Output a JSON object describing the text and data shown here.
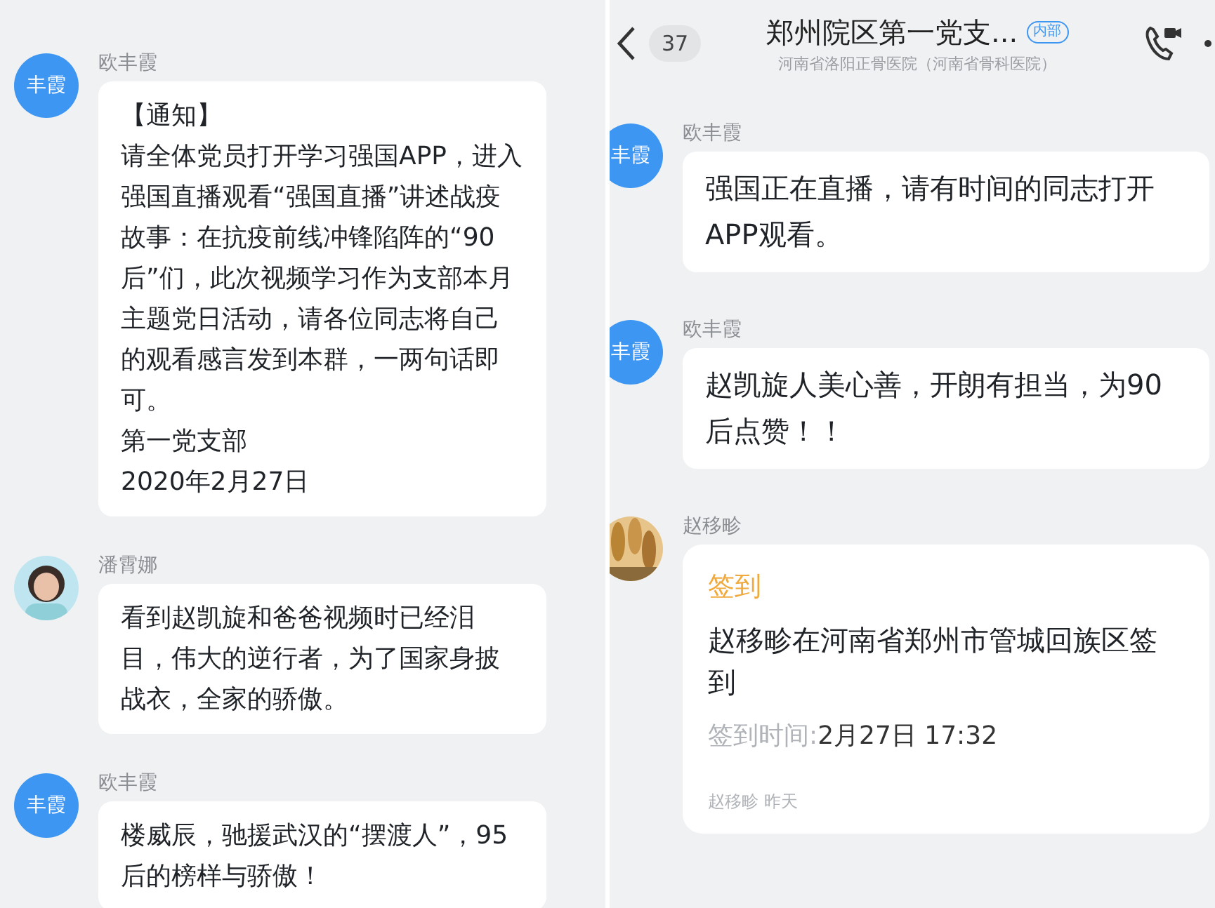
{
  "left_panel": {
    "messages": [
      {
        "sender": "欧丰霞",
        "avatar": {
          "kind": "initials",
          "text": "丰霞"
        },
        "kind": "text",
        "paragraphs": [
          "【通知】",
          "请全体党员打开学习强国APP，进入强国直播观看“强国直播”讲述战疫故事：在抗疫前线冲锋陷阵的“90后”们，此次视频学习作为支部本月主题党日活动，请各位同志将自己的观看感言发到本群，一两句话即可。",
          "第一党支部",
          "2020年2月27日"
        ]
      },
      {
        "sender": "潘霄娜",
        "kind": "text",
        "paragraphs": [
          "看到赵凯旋和爸爸视频时已经泪目，伟大的逆行者，为了国家身披战衣，全家的骄傲。"
        ]
      },
      {
        "sender": "欧丰霞",
        "avatar": {
          "kind": "initials",
          "text": "丰霞"
        },
        "kind": "text",
        "paragraphs": [
          "楼威辰，驰援武汉的“摆渡人”，95后的榜样与骄傲！"
        ]
      }
    ]
  },
  "right_panel": {
    "header": {
      "unread": "37",
      "title": "郑州院区第一党支...",
      "tag": "内部",
      "subtitle": "河南省洛阳正骨医院（河南省骨科医院）"
    },
    "messages": [
      {
        "sender": "欧丰霞",
        "avatar": {
          "kind": "initials",
          "text": "丰霞"
        },
        "kind": "text",
        "paragraphs": [
          "强国正在直播，请有时间的同志打开APP观看。"
        ]
      },
      {
        "sender": "欧丰霞",
        "avatar": {
          "kind": "initials",
          "text": "丰霞"
        },
        "kind": "text",
        "paragraphs": [
          "赵凯旋人美心善，开朗有担当，为90后点赞！！"
        ]
      },
      {
        "sender": "赵移畛",
        "kind": "checkin",
        "title": "签到",
        "body": "赵移畛在河南省郑州市管城回族区签到",
        "time_label": "签到时间:",
        "time": "2月27日 17:32",
        "footer": "赵移畛 昨天"
      }
    ]
  }
}
